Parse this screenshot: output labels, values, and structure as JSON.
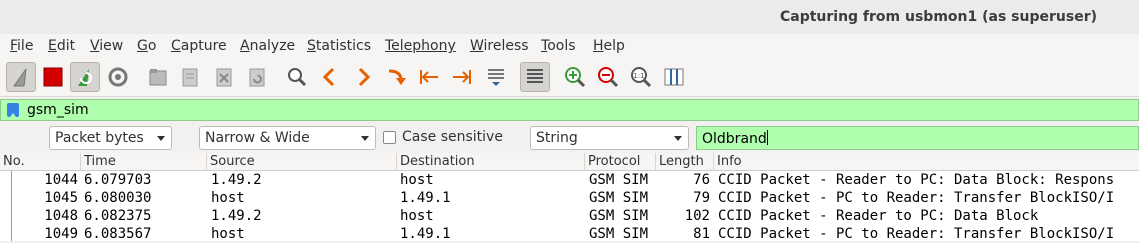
{
  "window": {
    "title": "Capturing from usbmon1 (as superuser)"
  },
  "menu": {
    "items": [
      {
        "label": "File",
        "key": "F",
        "rest": "ile"
      },
      {
        "label": "Edit",
        "key": "E",
        "rest": "dit"
      },
      {
        "label": "View",
        "key": "V",
        "rest": "iew"
      },
      {
        "label": "Go",
        "key": "G",
        "rest": "o"
      },
      {
        "label": "Capture",
        "key": "C",
        "rest": "apture"
      },
      {
        "label": "Analyze",
        "key": "A",
        "rest": "nalyze"
      },
      {
        "label": "Statistics",
        "key": "S",
        "rest": "tatistics"
      },
      {
        "label": "Telephony",
        "key": "",
        "rest": "Telephony"
      },
      {
        "label": "Wireless",
        "key": "W",
        "rest": "ireless"
      },
      {
        "label": "Tools",
        "key": "T",
        "rest": "ools"
      },
      {
        "label": "Help",
        "key": "H",
        "rest": "elp"
      }
    ]
  },
  "toolbar": {
    "icons": [
      "shark-fin-icon",
      "stop-icon",
      "restart-capture-icon",
      "capture-options-icon",
      "open-file-icon",
      "save-file-icon",
      "close-file-icon",
      "reload-file-icon",
      "find-packet-icon",
      "go-back-icon",
      "go-forward-icon",
      "go-to-packet-icon",
      "first-packet-icon",
      "last-packet-icon",
      "autoscroll-icon",
      "colorize-icon",
      "zoom-in-icon",
      "zoom-out-icon",
      "normal-size-icon",
      "resize-columns-icon"
    ]
  },
  "display_filter": {
    "value": "gsm_sim"
  },
  "find": {
    "search_in": "Packet bytes",
    "char_width": "Narrow & Wide",
    "case_sensitive_label": "Case sensitive",
    "search_type": "String",
    "search_value": "Oldbrand"
  },
  "columns": [
    "No.",
    "Time",
    "Source",
    "Destination",
    "Protocol",
    "Length",
    "Info"
  ],
  "packets": [
    {
      "no": "1044",
      "time": "6.079703",
      "source": "1.49.2",
      "destination": "host",
      "protocol": "GSM SIM",
      "length": "76",
      "info": "CCID Packet - Reader to PC: Data Block: Respons"
    },
    {
      "no": "1045",
      "time": "6.080030",
      "source": "host",
      "destination": "1.49.1",
      "protocol": "GSM SIM",
      "length": "79",
      "info": "CCID Packet - PC to Reader: Transfer BlockISO/I"
    },
    {
      "no": "1048",
      "time": "6.082375",
      "source": "1.49.2",
      "destination": "host",
      "protocol": "GSM SIM",
      "length": "102",
      "info": "CCID Packet - Reader to PC: Data Block"
    },
    {
      "no": "1049",
      "time": "6.083567",
      "source": "host",
      "destination": "1.49.1",
      "protocol": "GSM SIM",
      "length": "81",
      "info": "CCID Packet - PC to Reader: Transfer BlockISO/I"
    }
  ],
  "colors": {
    "filter_valid_bg": "#afffaf",
    "stop_red": "#d40000",
    "accent_green": "#3a9a3a",
    "nav_orange": "#e66000"
  }
}
